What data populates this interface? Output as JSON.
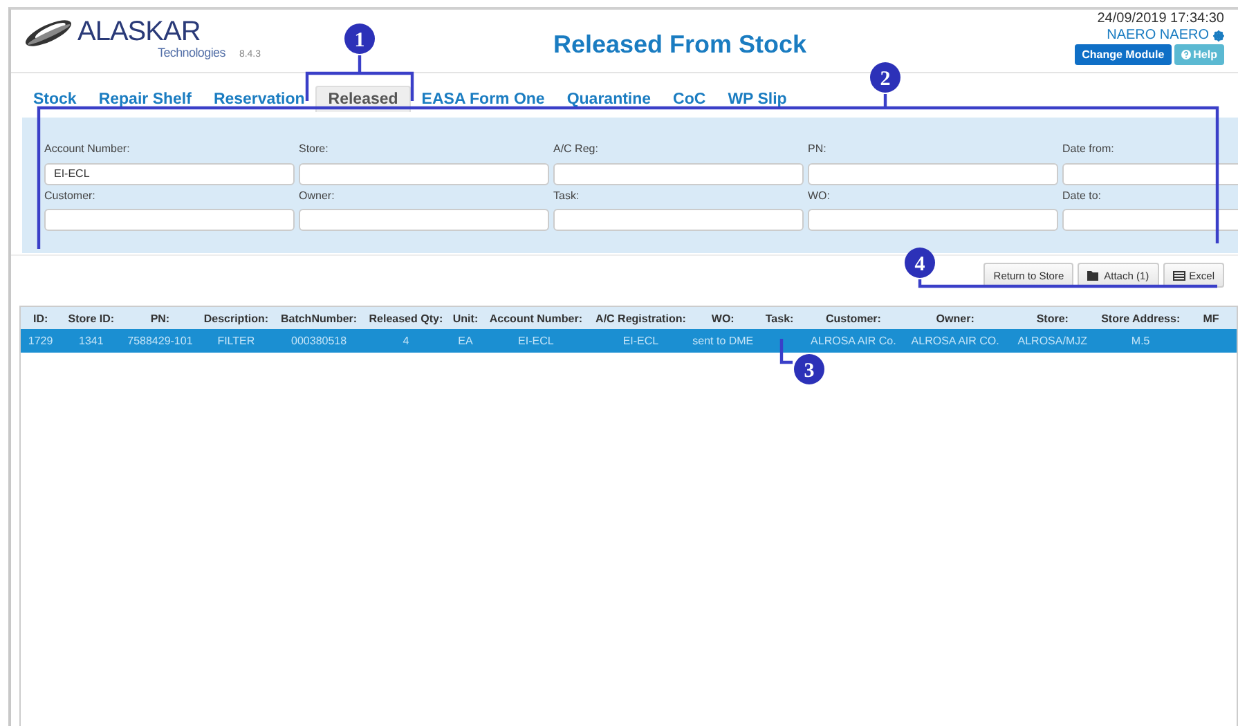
{
  "header": {
    "logo": {
      "name": "ALASKAR",
      "subtitle": "Technologies",
      "version": "8.4.3"
    },
    "title": "Released From Stock",
    "datetime": "24/09/2019 17:34:30",
    "user": "NAERO NAERO",
    "buttons": [
      {
        "label": "Change Module",
        "kind": "primary"
      },
      {
        "label": "Help",
        "kind": "help"
      }
    ]
  },
  "tabs": [
    {
      "label": "Stock",
      "selected": false
    },
    {
      "label": "Repair Shelf",
      "selected": false
    },
    {
      "label": "Reservation",
      "selected": false
    },
    {
      "label": "Released",
      "selected": true
    },
    {
      "label": "EASA Form One",
      "selected": false
    },
    {
      "label": "Quarantine",
      "selected": false
    },
    {
      "label": "CoC",
      "selected": false
    },
    {
      "label": "WP Slip",
      "selected": false
    }
  ],
  "filters": [
    {
      "label": "Account Number:",
      "value": "EI-ECL"
    },
    {
      "label": "Store:"
    },
    {
      "label": "A/C Reg:"
    },
    {
      "label": "PN:"
    },
    {
      "label": "Date from:"
    },
    {
      "label": "Customer:"
    },
    {
      "label": "Owner:"
    },
    {
      "label": "Task:"
    },
    {
      "label": "WO:"
    },
    {
      "label": "Date to:"
    }
  ],
  "actions": [
    {
      "label": "Return to Store",
      "kind": "plain"
    },
    {
      "label": "Attach (1)",
      "kind": "attach"
    },
    {
      "label": "Excel",
      "kind": "excel"
    }
  ],
  "table": {
    "columns": [
      "ID:",
      "Store ID:",
      "PN:",
      "Description:",
      "BatchNumber:",
      "Released Qty:",
      "Unit:",
      "Account Number:",
      "A/C Registration:",
      "WO:",
      "Task:",
      "Customer:",
      "Owner:",
      "Store:",
      "Store Address:",
      "MF"
    ],
    "rows": [
      {
        "selected": true,
        "cells": [
          "1729",
          "1341",
          "7588429-101",
          "FILTER",
          "000380518",
          "4",
          "EA",
          "EI-ECL",
          "EI-ECL",
          "sent to DME",
          null,
          "ALROSA AIR Co.",
          "ALROSA AIR CO.",
          "ALROSA/MJZ",
          "M.5"
        ]
      }
    ]
  },
  "callouts": [
    {
      "number": "1"
    },
    {
      "number": "2"
    },
    {
      "number": "3"
    },
    {
      "number": "4"
    }
  ]
}
